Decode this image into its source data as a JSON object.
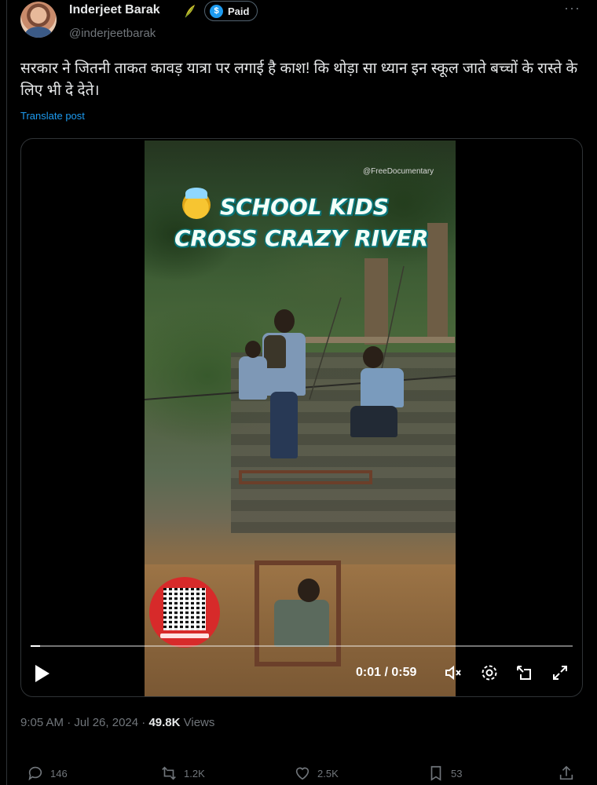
{
  "author": {
    "name": "Inderjeet Barak",
    "handle": "@inderjeetbarak",
    "badge_label": "Paid",
    "badge_icon": "dollar-coin-icon"
  },
  "more_label": "···",
  "tweet": {
    "text": "सरकार ने जितनी ताकत कावड़ यात्रा पर लगाई है काश! कि थोड़ा सा ध्यान इन स्कूल जाते बच्चों के रास्ते के लिए भी दे देते।",
    "translate_label": "Translate post"
  },
  "video": {
    "overlay_line1": "SCHOOL KIDS",
    "overlay_line2": "CROSS CRAZY RIVER",
    "watermark": "@FreeDocumentary",
    "timecode": "0:01 / 0:59",
    "progress_fraction": 0.017,
    "controls": [
      "play-icon",
      "mute-icon",
      "settings-icon",
      "pip-icon",
      "fullscreen-icon"
    ]
  },
  "meta": {
    "time": "9:05 AM · Jul 26, 2024 · ",
    "views_count": "49.8K",
    "views_label": " Views"
  },
  "actions": {
    "replies": "146",
    "reposts": "1.2K",
    "likes": "2.5K",
    "bookmarks": "53"
  },
  "colors": {
    "accent": "#1d9bf0",
    "muted": "#71767b",
    "text": "#e7e9ea",
    "background": "#000000"
  }
}
